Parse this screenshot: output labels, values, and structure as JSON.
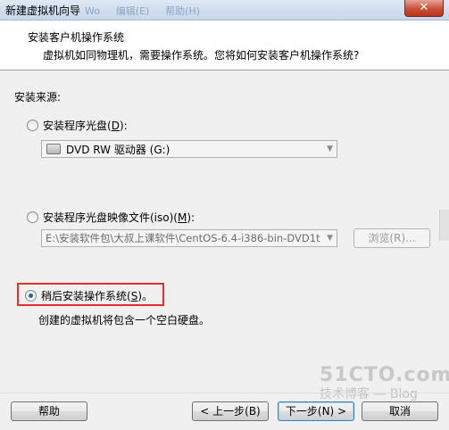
{
  "window": {
    "title": "新建虚拟机向导",
    "title_ghosts": [
      "Wo",
      "编辑(E)",
      "帮助(H)"
    ],
    "close_glyph": "✕"
  },
  "header": {
    "title": "安装客户机操作系统",
    "subtitle": "虚拟机如同物理机，需要操作系统。您将如何安装客户机操作系统?"
  },
  "install_source": {
    "label": "安装来源:",
    "options": [
      {
        "label": "安装程序光盘",
        "mnemonic": "D",
        "checked": false
      },
      {
        "label": "安装程序光盘映像文件(iso)",
        "mnemonic": "M",
        "checked": false
      },
      {
        "label": "稍后安装操作系统",
        "mnemonic": "S",
        "suffix": "。",
        "checked": true
      }
    ],
    "drive_select": {
      "value": "DVD RW 驱动器 (G:)",
      "icon": "optical-drive-icon"
    },
    "iso_path": {
      "value": "E:\\安装软件包\\大叔上课软件\\CentOS-6.4-i386-bin-DVD1t",
      "browse_label": "浏览(R)..."
    },
    "later_hint": "创建的虚拟机将包含一个空白硬盘。"
  },
  "buttons": {
    "help": "帮助",
    "back": "< 上一步(B)",
    "next": "下一步(N) >",
    "cancel": "取消"
  },
  "watermark": {
    "line1": "51CTO.com",
    "line2": "技术博客 — Blog"
  },
  "colors": {
    "highlight_border": "#e0322d",
    "header_bg": "#ffffff",
    "window_bg": "#f0f0f0"
  }
}
